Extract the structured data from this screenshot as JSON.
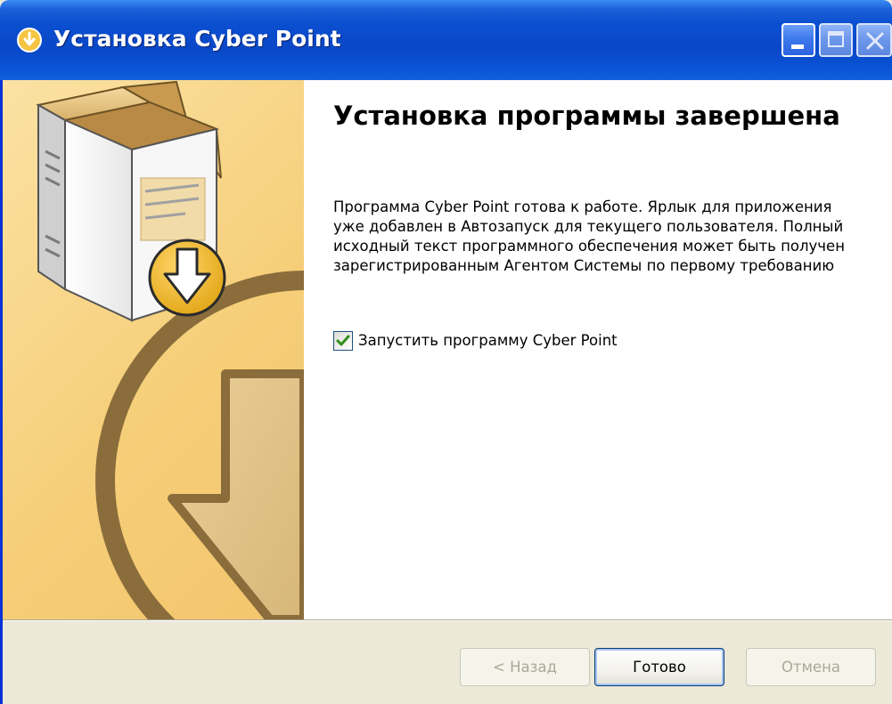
{
  "window": {
    "title": "Установка Cyber Point"
  },
  "page": {
    "heading": "Установка программы завершена",
    "description": "Программа Cyber Point готова к работе. Ярлык для приложения уже добавлен в Автозапуск для текущего пользователя. Полный исходный текст программного обеспечения может быть получен зарегистрированным Агентом Системы по первому требованию"
  },
  "options": {
    "launch_label": "Запустить программу Cyber Point",
    "launch_checked": true
  },
  "buttons": {
    "back": "< Назад",
    "finish": "Готово",
    "cancel": "Отмена"
  },
  "icons": {
    "app": "installer-disc-icon",
    "minimize": "minimize-icon",
    "maximize": "maximize-icon",
    "close": "close-icon",
    "checkmark": "checkmark-icon"
  },
  "colors": {
    "titlebar": "#0a4fd0",
    "side_panel": "#f6cf7a",
    "accent_brown": "#8a6d3b",
    "checkmark": "#2f8e1c"
  }
}
